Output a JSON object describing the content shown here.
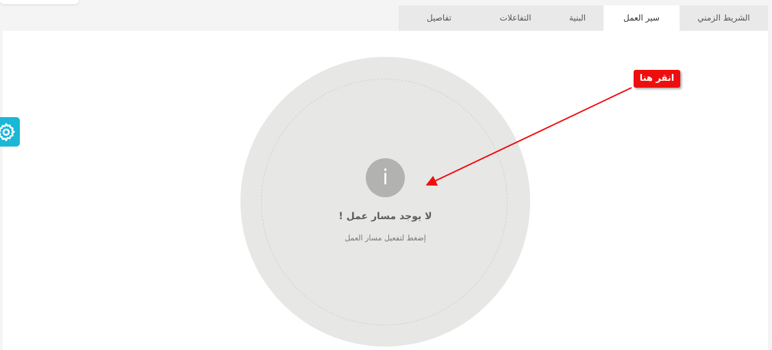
{
  "tabs": [
    {
      "label": "تفاصيل",
      "active": false
    },
    {
      "label": "التفاعلات",
      "active": false
    },
    {
      "label": "البنية",
      "active": false
    },
    {
      "label": "سير العمل",
      "active": true
    },
    {
      "label": "الشريط الزمني",
      "active": false
    }
  ],
  "empty_state": {
    "icon": "info-icon",
    "icon_glyph": "i",
    "title": "لا يوجد مسار عمل !",
    "subtitle": "إضغط لتفعيل مسار العمل"
  },
  "settings_button": {
    "icon": "gear-icon",
    "color": "#1ab8d6"
  },
  "annotation": {
    "label": "انقر هنا",
    "color": "#ef0e0e"
  }
}
